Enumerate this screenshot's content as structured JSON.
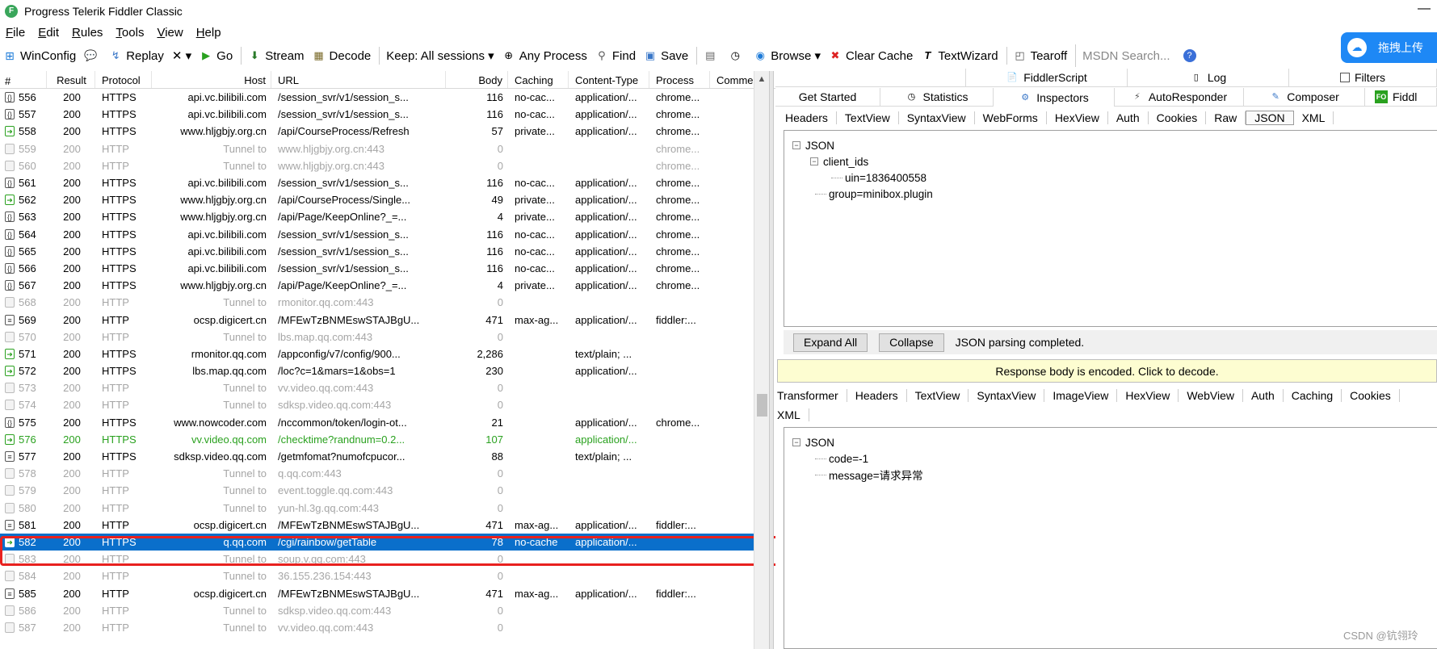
{
  "window": {
    "title": "Progress Telerik Fiddler Classic",
    "min_symbol": "—"
  },
  "menu": [
    {
      "label": "File",
      "u": "F",
      "rest": "ile"
    },
    {
      "label": "Edit",
      "u": "E",
      "rest": "dit"
    },
    {
      "label": "Rules",
      "u": "R",
      "rest": "ules"
    },
    {
      "label": "Tools",
      "u": "T",
      "rest": "ools"
    },
    {
      "label": "View",
      "u": "V",
      "rest": "iew"
    },
    {
      "label": "Help",
      "u": "H",
      "rest": "elp"
    }
  ],
  "toolbar": {
    "winconfig": "WinConfig",
    "replay": "Replay",
    "remove": "✕ ▾",
    "go": "Go",
    "stream": "Stream",
    "decode": "Decode",
    "keep": "Keep: All sessions ▾",
    "any_process": "Any Process",
    "find": "Find",
    "save": "Save",
    "browse": "Browse ▾",
    "clear_cache": "Clear Cache",
    "textwizard": "TextWizard",
    "tearoff": "Tearoff",
    "msdn_placeholder": "MSDN Search...",
    "upload": "拖拽上传"
  },
  "grid": {
    "headers": [
      "#",
      "Result",
      "Protocol",
      "Host",
      "URL",
      "Body",
      "Caching",
      "Content-Type",
      "Process",
      "Comments"
    ],
    "rows": [
      {
        "id": "556",
        "res": "200",
        "proto": "HTTPS",
        "host": "api.vc.bilibili.com",
        "url": "/session_svr/v1/session_s...",
        "body": "116",
        "cache": "no-cac...",
        "ctype": "application/...",
        "proc": "chrome...",
        "type": "json"
      },
      {
        "id": "557",
        "res": "200",
        "proto": "HTTPS",
        "host": "api.vc.bilibili.com",
        "url": "/session_svr/v1/session_s...",
        "body": "116",
        "cache": "no-cac...",
        "ctype": "application/...",
        "proc": "chrome...",
        "type": "json"
      },
      {
        "id": "558",
        "res": "200",
        "proto": "HTTPS",
        "host": "www.hljgbjy.org.cn",
        "url": "/api/CourseProcess/Refresh",
        "body": "57",
        "cache": "private...",
        "ctype": "application/...",
        "proc": "chrome...",
        "type": "get"
      },
      {
        "id": "559",
        "res": "200",
        "proto": "HTTP",
        "host": "Tunnel to",
        "url": "www.hljgbjy.org.cn:443",
        "body": "0",
        "cache": "",
        "ctype": "",
        "proc": "chrome...",
        "type": "tunnel"
      },
      {
        "id": "560",
        "res": "200",
        "proto": "HTTP",
        "host": "Tunnel to",
        "url": "www.hljgbjy.org.cn:443",
        "body": "0",
        "cache": "",
        "ctype": "",
        "proc": "chrome...",
        "type": "tunnel"
      },
      {
        "id": "561",
        "res": "200",
        "proto": "HTTPS",
        "host": "api.vc.bilibili.com",
        "url": "/session_svr/v1/session_s...",
        "body": "116",
        "cache": "no-cac...",
        "ctype": "application/...",
        "proc": "chrome...",
        "type": "json"
      },
      {
        "id": "562",
        "res": "200",
        "proto": "HTTPS",
        "host": "www.hljgbjy.org.cn",
        "url": "/api/CourseProcess/Single...",
        "body": "49",
        "cache": "private...",
        "ctype": "application/...",
        "proc": "chrome...",
        "type": "get"
      },
      {
        "id": "563",
        "res": "200",
        "proto": "HTTPS",
        "host": "www.hljgbjy.org.cn",
        "url": "/api/Page/KeepOnline?_=...",
        "body": "4",
        "cache": "private...",
        "ctype": "application/...",
        "proc": "chrome...",
        "type": "json"
      },
      {
        "id": "564",
        "res": "200",
        "proto": "HTTPS",
        "host": "api.vc.bilibili.com",
        "url": "/session_svr/v1/session_s...",
        "body": "116",
        "cache": "no-cac...",
        "ctype": "application/...",
        "proc": "chrome...",
        "type": "json"
      },
      {
        "id": "565",
        "res": "200",
        "proto": "HTTPS",
        "host": "api.vc.bilibili.com",
        "url": "/session_svr/v1/session_s...",
        "body": "116",
        "cache": "no-cac...",
        "ctype": "application/...",
        "proc": "chrome...",
        "type": "json"
      },
      {
        "id": "566",
        "res": "200",
        "proto": "HTTPS",
        "host": "api.vc.bilibili.com",
        "url": "/session_svr/v1/session_s...",
        "body": "116",
        "cache": "no-cac...",
        "ctype": "application/...",
        "proc": "chrome...",
        "type": "json"
      },
      {
        "id": "567",
        "res": "200",
        "proto": "HTTPS",
        "host": "www.hljgbjy.org.cn",
        "url": "/api/Page/KeepOnline?_=...",
        "body": "4",
        "cache": "private...",
        "ctype": "application/...",
        "proc": "chrome...",
        "type": "json"
      },
      {
        "id": "568",
        "res": "200",
        "proto": "HTTP",
        "host": "Tunnel to",
        "url": "rmonitor.qq.com:443",
        "body": "0",
        "cache": "",
        "ctype": "",
        "proc": "",
        "type": "tunnel"
      },
      {
        "id": "569",
        "res": "200",
        "proto": "HTTP",
        "host": "ocsp.digicert.cn",
        "url": "/MFEwTzBNMEswSTAJBgU...",
        "body": "471",
        "cache": "max-ag...",
        "ctype": "application/...",
        "proc": "fiddler:...",
        "type": "doc"
      },
      {
        "id": "570",
        "res": "200",
        "proto": "HTTP",
        "host": "Tunnel to",
        "url": "lbs.map.qq.com:443",
        "body": "0",
        "cache": "",
        "ctype": "",
        "proc": "",
        "type": "tunnel"
      },
      {
        "id": "571",
        "res": "200",
        "proto": "HTTPS",
        "host": "rmonitor.qq.com",
        "url": "/appconfig/v7/config/900...",
        "body": "2,286",
        "cache": "",
        "ctype": "text/plain; ...",
        "proc": "",
        "type": "get"
      },
      {
        "id": "572",
        "res": "200",
        "proto": "HTTPS",
        "host": "lbs.map.qq.com",
        "url": "/loc?c=1&mars=1&obs=1",
        "body": "230",
        "cache": "",
        "ctype": "application/...",
        "proc": "",
        "type": "get"
      },
      {
        "id": "573",
        "res": "200",
        "proto": "HTTP",
        "host": "Tunnel to",
        "url": "vv.video.qq.com:443",
        "body": "0",
        "cache": "",
        "ctype": "",
        "proc": "",
        "type": "tunnel"
      },
      {
        "id": "574",
        "res": "200",
        "proto": "HTTP",
        "host": "Tunnel to",
        "url": "sdksp.video.qq.com:443",
        "body": "0",
        "cache": "",
        "ctype": "",
        "proc": "",
        "type": "tunnel"
      },
      {
        "id": "575",
        "res": "200",
        "proto": "HTTPS",
        "host": "www.nowcoder.com",
        "url": "/nccommon/token/login-ot...",
        "body": "21",
        "cache": "",
        "ctype": "application/...",
        "proc": "chrome...",
        "type": "json"
      },
      {
        "id": "576",
        "res": "200",
        "proto": "HTTPS",
        "host": "vv.video.qq.com",
        "url": "/checktime?randnum=0.2...",
        "body": "107",
        "cache": "",
        "ctype": "application/...",
        "proc": "",
        "type": "green"
      },
      {
        "id": "577",
        "res": "200",
        "proto": "HTTPS",
        "host": "sdksp.video.qq.com",
        "url": "/getmfomat?numofcpucor...",
        "body": "88",
        "cache": "",
        "ctype": "text/plain; ...",
        "proc": "",
        "type": "doc"
      },
      {
        "id": "578",
        "res": "200",
        "proto": "HTTP",
        "host": "Tunnel to",
        "url": "q.qq.com:443",
        "body": "0",
        "cache": "",
        "ctype": "",
        "proc": "",
        "type": "tunnel"
      },
      {
        "id": "579",
        "res": "200",
        "proto": "HTTP",
        "host": "Tunnel to",
        "url": "event.toggle.qq.com:443",
        "body": "0",
        "cache": "",
        "ctype": "",
        "proc": "",
        "type": "tunnel"
      },
      {
        "id": "580",
        "res": "200",
        "proto": "HTTP",
        "host": "Tunnel to",
        "url": "yun-hl.3g.qq.com:443",
        "body": "0",
        "cache": "",
        "ctype": "",
        "proc": "",
        "type": "tunnel"
      },
      {
        "id": "581",
        "res": "200",
        "proto": "HTTP",
        "host": "ocsp.digicert.cn",
        "url": "/MFEwTzBNMEswSTAJBgU...",
        "body": "471",
        "cache": "max-ag...",
        "ctype": "application/...",
        "proc": "fiddler:...",
        "type": "doc"
      },
      {
        "id": "582",
        "res": "200",
        "proto": "HTTPS",
        "host": "q.qq.com",
        "url": "/cgi/rainbow/getTable",
        "body": "78",
        "cache": "no-cache",
        "ctype": "application/...",
        "proc": "",
        "type": "selected"
      },
      {
        "id": "583",
        "res": "200",
        "proto": "HTTP",
        "host": "Tunnel to",
        "url": "soup.v.qq.com:443",
        "body": "0",
        "cache": "",
        "ctype": "",
        "proc": "",
        "type": "tunnel"
      },
      {
        "id": "584",
        "res": "200",
        "proto": "HTTP",
        "host": "Tunnel to",
        "url": "36.155.236.154:443",
        "body": "0",
        "cache": "",
        "ctype": "",
        "proc": "",
        "type": "tunnel"
      },
      {
        "id": "585",
        "res": "200",
        "proto": "HTTP",
        "host": "ocsp.digicert.cn",
        "url": "/MFEwTzBNMEswSTAJBgU...",
        "body": "471",
        "cache": "max-ag...",
        "ctype": "application/...",
        "proc": "fiddler:...",
        "type": "doc"
      },
      {
        "id": "586",
        "res": "200",
        "proto": "HTTP",
        "host": "Tunnel to",
        "url": "sdksp.video.qq.com:443",
        "body": "0",
        "cache": "",
        "ctype": "",
        "proc": "",
        "type": "tunnel"
      },
      {
        "id": "587",
        "res": "200",
        "proto": "HTTP",
        "host": "Tunnel to",
        "url": "vv.video.qq.com:443",
        "body": "0",
        "cache": "",
        "ctype": "",
        "proc": "",
        "type": "tunnel"
      }
    ]
  },
  "right": {
    "top_tabs_1": [
      "FiddlerScript",
      "Log",
      "Filters"
    ],
    "top_tabs_2": [
      "Get Started",
      "Statistics",
      "Inspectors",
      "AutoResponder",
      "Composer",
      "Fiddl"
    ],
    "request_tabs": [
      "Headers",
      "TextView",
      "SyntaxView",
      "WebForms",
      "HexView",
      "Auth",
      "Cookies",
      "Raw",
      "JSON",
      "XML"
    ],
    "request_tree": {
      "root": "JSON",
      "child": "client_ids",
      "leaf": "uin=1836400558",
      "sibling": "group=minibox.plugin"
    },
    "expand_all": "Expand All",
    "collapse": "Collapse",
    "parse_status": "JSON parsing completed.",
    "encoded_notice": "Response body is encoded. Click to decode.",
    "response_tabs": [
      "Transformer",
      "Headers",
      "TextView",
      "SyntaxView",
      "ImageView",
      "HexView",
      "WebView",
      "Auth",
      "Caching",
      "Cookies"
    ],
    "response_tabs_2": [
      "XML"
    ],
    "response_tree": {
      "root": "JSON",
      "a": "code=-1",
      "b": "message=请求异常"
    }
  },
  "watermark": "CSDN @钪翎玲",
  "colors": {
    "selected": "#0a6fcb",
    "tunnel": "#a6a6a6",
    "green": "#2aa11f",
    "highlight": "#e8211f"
  }
}
